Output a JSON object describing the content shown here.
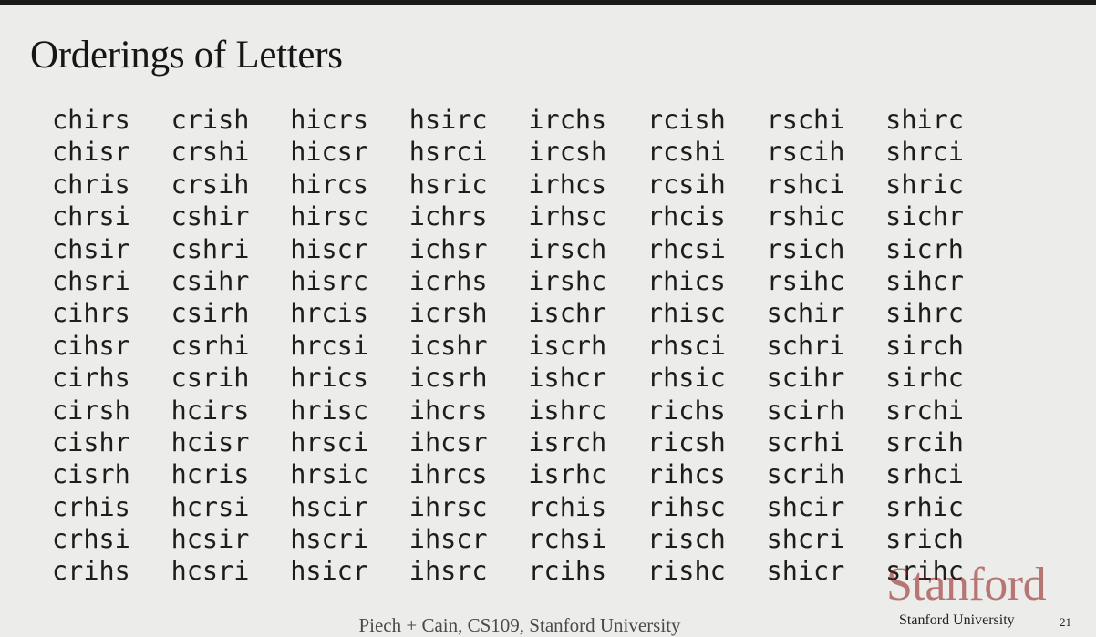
{
  "slide": {
    "title": "Orderings of Letters",
    "footer_credit": "Piech + Cain, CS109, Stanford University",
    "logo_wordmark": "Stanford",
    "logo_subtitle": "Stanford University",
    "slide_number": "21"
  },
  "permutation_columns": [
    [
      "chirs",
      "chisr",
      "chris",
      "chrsi",
      "chsir",
      "chsri",
      "cihrs",
      "cihsr",
      "cirhs",
      "cirsh",
      "cishr",
      "cisrh",
      "crhis",
      "crhsi",
      "crihs"
    ],
    [
      "crish",
      "crshi",
      "crsih",
      "cshir",
      "cshri",
      "csihr",
      "csirh",
      "csrhi",
      "csrih",
      "hcirs",
      "hcisr",
      "hcris",
      "hcrsi",
      "hcsir",
      "hcsri"
    ],
    [
      "hicrs",
      "hicsr",
      "hircs",
      "hirsc",
      "hiscr",
      "hisrc",
      "hrcis",
      "hrcsi",
      "hrics",
      "hrisc",
      "hrsci",
      "hrsic",
      "hscir",
      "hscri",
      "hsicr"
    ],
    [
      "hsirc",
      "hsrci",
      "hsric",
      "ichrs",
      "ichsr",
      "icrhs",
      "icrsh",
      "icshr",
      "icsrh",
      "ihcrs",
      "ihcsr",
      "ihrcs",
      "ihrsc",
      "ihscr",
      "ihsrc"
    ],
    [
      "irchs",
      "ircsh",
      "irhcs",
      "irhsc",
      "irsch",
      "irshc",
      "ischr",
      "iscrh",
      "ishcr",
      "ishrc",
      "isrch",
      "isrhc",
      "rchis",
      "rchsi",
      "rcihs"
    ],
    [
      "rcish",
      "rcshi",
      "rcsih",
      "rhcis",
      "rhcsi",
      "rhics",
      "rhisc",
      "rhsci",
      "rhsic",
      "richs",
      "ricsh",
      "rihcs",
      "rihsc",
      "risch",
      "rishc"
    ],
    [
      "rschi",
      "rscih",
      "rshci",
      "rshic",
      "rsich",
      "rsihc",
      "schir",
      "schri",
      "scihr",
      "scirh",
      "scrhi",
      "scrih",
      "shcir",
      "shcri",
      "shicr"
    ],
    [
      "shirc",
      "shrci",
      "shric",
      "sichr",
      "sicrh",
      "sihcr",
      "sihrc",
      "sirch",
      "sirhc",
      "srchi",
      "srcih",
      "srhci",
      "srhic",
      "srich",
      "srihc"
    ]
  ]
}
